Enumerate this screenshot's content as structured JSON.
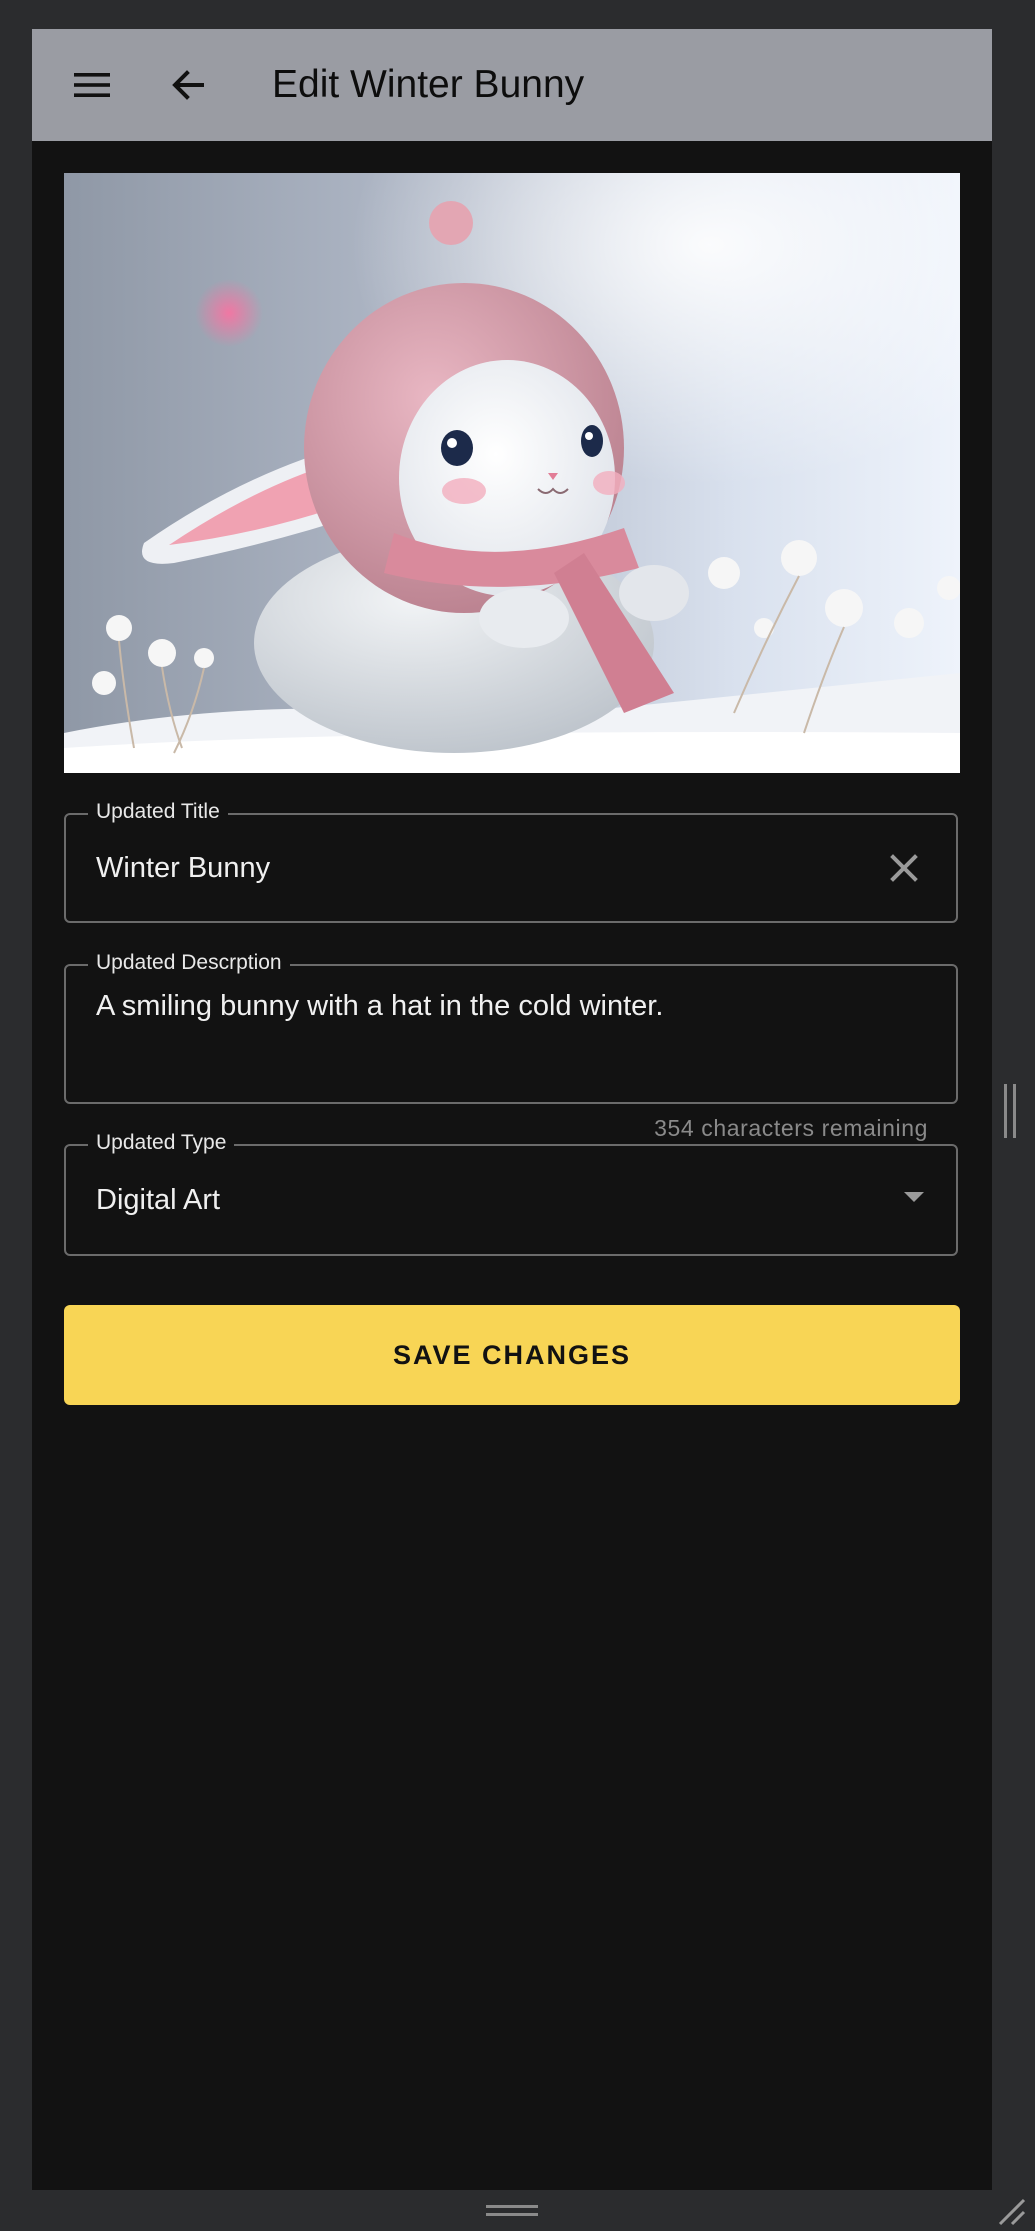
{
  "appbar": {
    "title": "Edit Winter Bunny",
    "menu_icon": "hamburger-menu-icon",
    "back_icon": "arrow-back-icon",
    "background_color": "#9a9ca3"
  },
  "image": {
    "subject": "cute white bunny wearing pink knit hood and scarf in snow"
  },
  "form": {
    "title_field": {
      "label": "Updated Title",
      "value": "Winter Bunny",
      "clear_icon": "close-icon"
    },
    "description_field": {
      "label": "Updated Descrption",
      "value": "A smiling bunny with a hat in the cold winter.",
      "counter": "354 characters remaining"
    },
    "type_field": {
      "label": "Updated Type",
      "value": "Digital Art",
      "dropdown_icon": "caret-down-icon"
    },
    "save_button": {
      "label": "SAVE CHANGES",
      "color": "#f8d555"
    }
  }
}
